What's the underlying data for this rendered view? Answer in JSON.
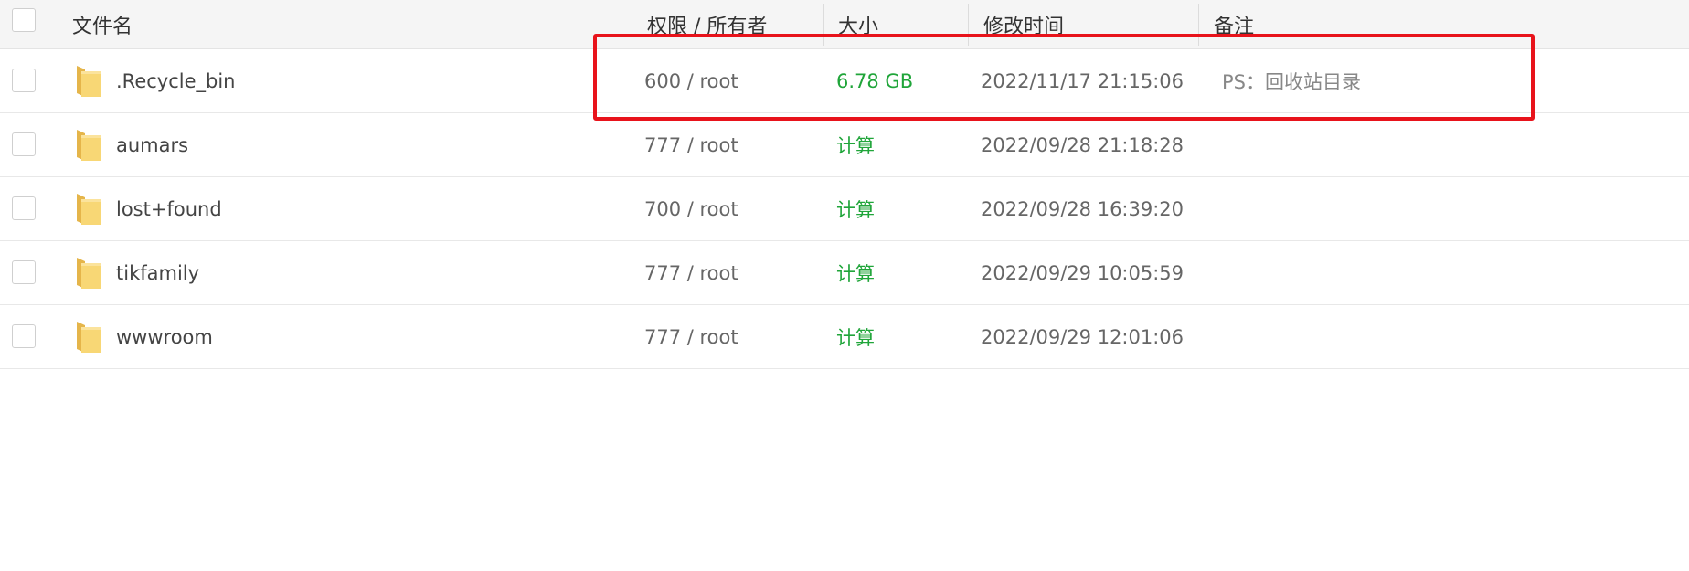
{
  "header": {
    "name": "文件名",
    "perm": "权限 / 所有者",
    "size": "大小",
    "mtime": "修改时间",
    "note": "备注"
  },
  "rows": [
    {
      "name": ".Recycle_bin",
      "perm": "600 / root",
      "size": "6.78 GB",
      "mtime": "2022/11/17 21:15:06",
      "note": "PS：回收站目录",
      "icon": "folder-icon"
    },
    {
      "name": "aumars",
      "perm": "777 / root",
      "size": "计算",
      "mtime": "2022/09/28 21:18:28",
      "note": "",
      "icon": "folder-icon"
    },
    {
      "name": "lost+found",
      "perm": "700 / root",
      "size": "计算",
      "mtime": "2022/09/28 16:39:20",
      "note": "",
      "icon": "folder-icon"
    },
    {
      "name": "tikfamily",
      "perm": "777 / root",
      "size": "计算",
      "mtime": "2022/09/29 10:05:59",
      "note": "",
      "icon": "folder-icon"
    },
    {
      "name": "wwwroom",
      "perm": "777 / root",
      "size": "计算",
      "mtime": "2022/09/29 12:01:06",
      "note": "",
      "icon": "folder-icon"
    }
  ],
  "colors": {
    "size_link": "#20a53a",
    "highlight_border": "#e8131b",
    "folder": "#f8d775"
  }
}
